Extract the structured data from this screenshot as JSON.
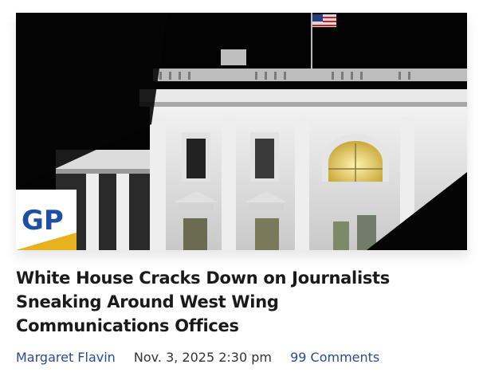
{
  "article": {
    "headline_lines": [
      "White House Cracks Down on Journalists",
      "Sneaking Around West Wing",
      "Communications Offices"
    ],
    "author": "Margaret Flavin",
    "date": "Nov. 3, 2025 2:30 pm",
    "comments": "99 Comments"
  },
  "image": {
    "subject": "white-house-at-night-photo"
  },
  "logo": {
    "text": "GP",
    "text_color": "#1e4fa3",
    "accent_color": "#e8b21f"
  },
  "colors": {
    "link": "#2a4a8f",
    "headline": "#1a1a1a",
    "meta_text": "#333333"
  }
}
